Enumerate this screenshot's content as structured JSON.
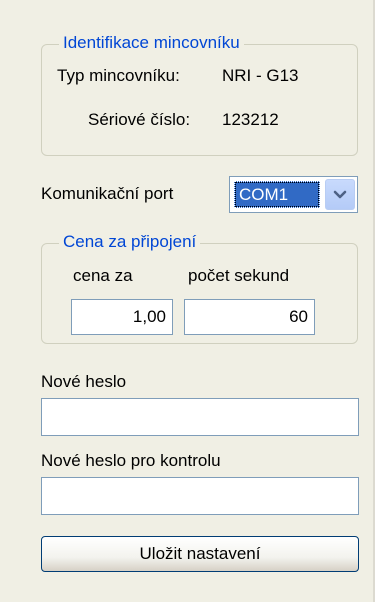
{
  "identification": {
    "legend": "Identifikace mincovníku",
    "type_label": "Typ mincovníku:",
    "type_value": "NRI - G13",
    "serial_label": "Sériové číslo:",
    "serial_value": "123212"
  },
  "port": {
    "label": "Komunikační port",
    "selected": "COM1",
    "dropdown_icon": "chevron-down-icon"
  },
  "price": {
    "legend": "Cena za připojení",
    "cost_label": "cena za",
    "seconds_label": "počet sekund",
    "cost_value": "1,00",
    "seconds_value": "60"
  },
  "password": {
    "new_label": "Nové heslo",
    "new_value": "",
    "confirm_label": "Nové heslo pro kontrolu",
    "confirm_value": ""
  },
  "actions": {
    "save_label": "Uložit nastavení"
  },
  "colors": {
    "panel_bg": "#f0efe4",
    "legend_text": "#0046d5",
    "selection_bg": "#316ac5"
  }
}
